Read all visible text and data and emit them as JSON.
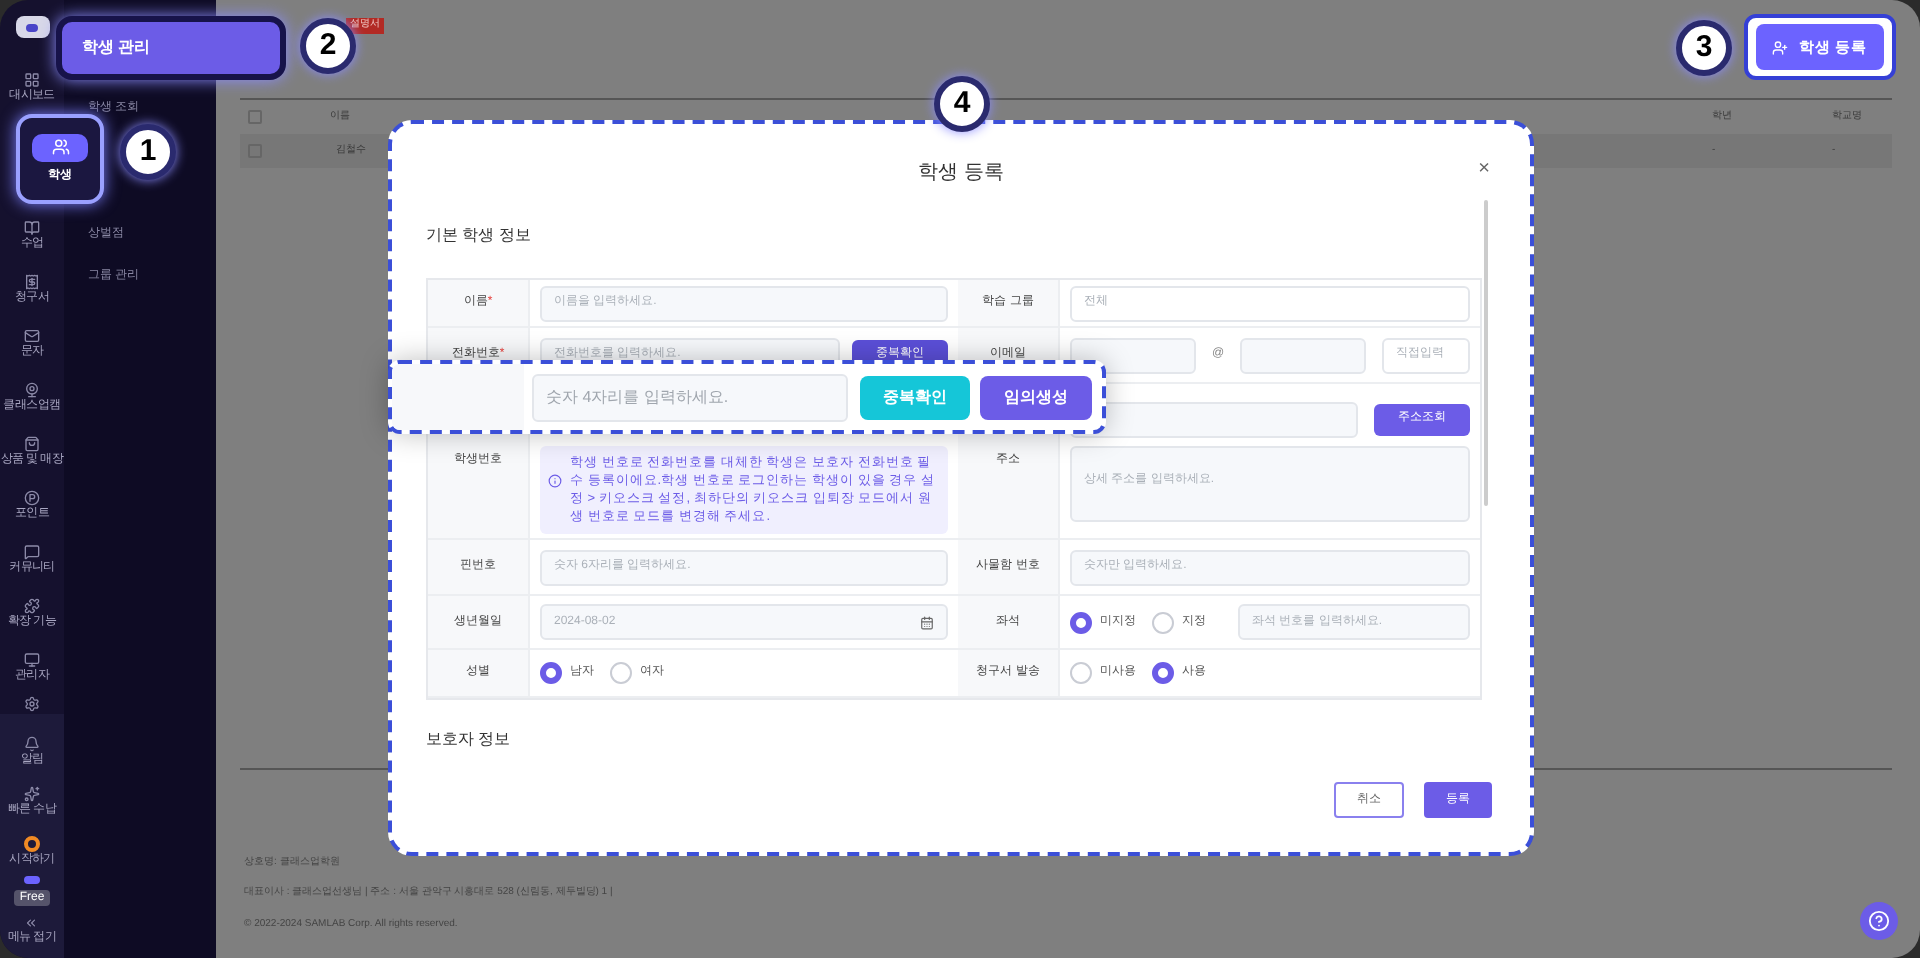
{
  "rail": {
    "items": [
      {
        "label": "대시보드",
        "selected": false
      },
      {
        "label": "학생",
        "selected": true
      },
      {
        "label": "수업",
        "selected": false
      },
      {
        "label": "청구서",
        "selected": false
      },
      {
        "label": "문자",
        "selected": false
      },
      {
        "label": "클래스업캠",
        "selected": false
      },
      {
        "label": "상품 및 매장",
        "selected": false
      },
      {
        "label": "포인트",
        "selected": false
      },
      {
        "label": "커뮤니티",
        "selected": false
      },
      {
        "label": "확장 기능",
        "selected": false
      },
      {
        "label": "관리자",
        "selected": false
      }
    ],
    "bottom_items": [
      {
        "label": "알림"
      },
      {
        "label": "빠른 수납"
      },
      {
        "label": "시작하기"
      }
    ],
    "plan_badge": "Free",
    "collapse": "메뉴 접기"
  },
  "submenu": {
    "title": "학생 관리",
    "items": [
      {
        "label": "학생 조회"
      },
      {
        "label": "상벌점"
      },
      {
        "label": "그룹 관리"
      }
    ]
  },
  "header": {
    "tag": "설명서",
    "register_button": "학생 등록"
  },
  "table": {
    "select_all_checked": false,
    "columns": [
      "이름",
      "학년",
      "학교명"
    ],
    "rows": [
      {
        "checked": false,
        "cells": [
          "김철수",
          "-",
          "-"
        ]
      }
    ]
  },
  "footer": [
    "상호명: 클래스업학원",
    "대표이사 : 클래스업선생님 | 주소 : 서울 관악구 시흥대로 528 (신림동, 제두빌딩) 1 |",
    "© 2022-2024 SAMLAB Corp. All rights reserved."
  ],
  "callouts": [
    "1",
    "2",
    "3",
    "4"
  ],
  "modal": {
    "title": "학생 등록",
    "close": "×",
    "required_mark": "*",
    "section": "기본 학생 정보",
    "section_2": "보호자 정보",
    "left": [
      {
        "kind": "input",
        "label": "이름",
        "required": true,
        "placeholder": "이름을 입력하세요."
      },
      {
        "kind": "input_button",
        "label": "전화번호",
        "required": true,
        "placeholder": "전화번호를 입력하세요.",
        "button": "중복확인"
      },
      {
        "kind": "info",
        "label": "학생번호",
        "required": false,
        "text": "학생 번호로 전화번호를 대체한 학생은 보호자 전화번호 필수 등록이에요.학생 번호로 로그인하는 학생이 있을 경우 설정 > 키오스크 설정, 최하단의 키오스크 입퇴장 모드에서 원생 번호로 모드를 변경해 주세요."
      },
      {
        "kind": "input",
        "label": "핀번호",
        "required": false,
        "placeholder": "숫자 6자리를 입력하세요."
      },
      {
        "kind": "date",
        "label": "생년월일",
        "required": false,
        "value": "2024-08-02"
      },
      {
        "kind": "radio",
        "label": "성별",
        "required": false,
        "options": [
          {
            "label": "남자",
            "selected": true
          },
          {
            "label": "여자",
            "selected": false
          }
        ]
      }
    ],
    "right": [
      {
        "kind": "value",
        "label": "학습 그룹",
        "value": "전체"
      },
      {
        "kind": "email",
        "label": "이메일",
        "at": "@",
        "select": "직접입력"
      },
      {
        "kind": "address",
        "label": "주소",
        "button": "주소조회",
        "placeholder": "상세 주소를 입력하세요."
      },
      {
        "kind": "input",
        "label": "사물함 번호",
        "placeholder": "숫자만 입력하세요."
      },
      {
        "kind": "radio_input",
        "label": "좌석",
        "options": [
          {
            "label": "미지정",
            "selected": true
          },
          {
            "label": "지정",
            "selected": false
          }
        ],
        "placeholder": "좌석 번호를 입력하세요."
      },
      {
        "kind": "radio",
        "label": "청구서 발송",
        "options": [
          {
            "label": "미사용",
            "selected": false
          },
          {
            "label": "사용",
            "selected": true
          }
        ]
      }
    ],
    "highlight_row": {
      "placeholder": "숫자 4자리를 입력하세요.",
      "check_button": "중복확인",
      "generate_button": "임의생성"
    },
    "buttons": {
      "cancel": "취소",
      "submit": "등록"
    }
  }
}
